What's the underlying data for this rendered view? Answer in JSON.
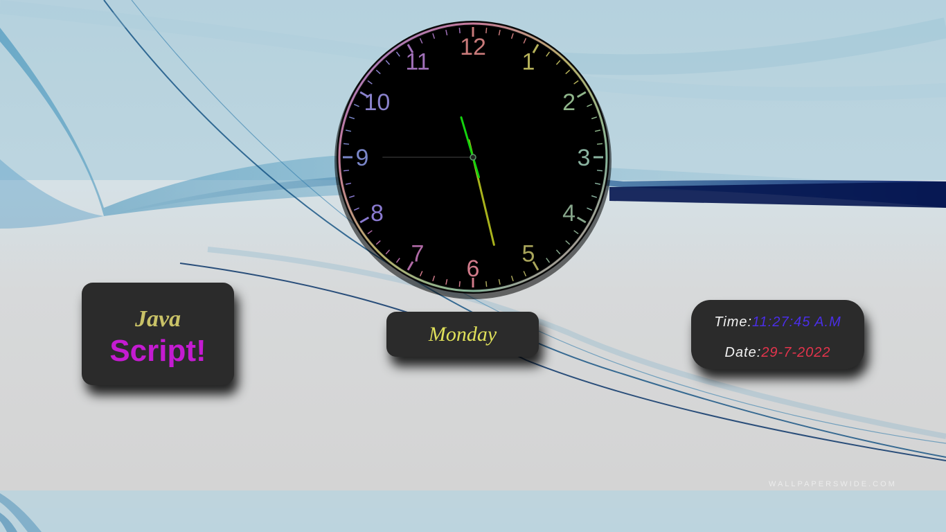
{
  "logo": {
    "line1": "Java",
    "line2": "Script!"
  },
  "clock": {
    "numerals": [
      "12",
      "1",
      "2",
      "3",
      "4",
      "5",
      "6",
      "7",
      "8",
      "9",
      "10",
      "11"
    ],
    "time": {
      "hours": 11,
      "minutes": 27,
      "seconds": 45
    },
    "face_color": "#000000",
    "hand_colors": {
      "hour": "#14d20e",
      "minute": "#a8b21c",
      "second": "#222222"
    }
  },
  "day": {
    "label": "Monday"
  },
  "datetime": {
    "time_label": "Time:",
    "time_value": "11:27:45 A.M",
    "date_label": "Date:",
    "date_value": "29-7-2022"
  },
  "watermark": {
    "text": "WALLPAPERSWIDE.COM"
  }
}
